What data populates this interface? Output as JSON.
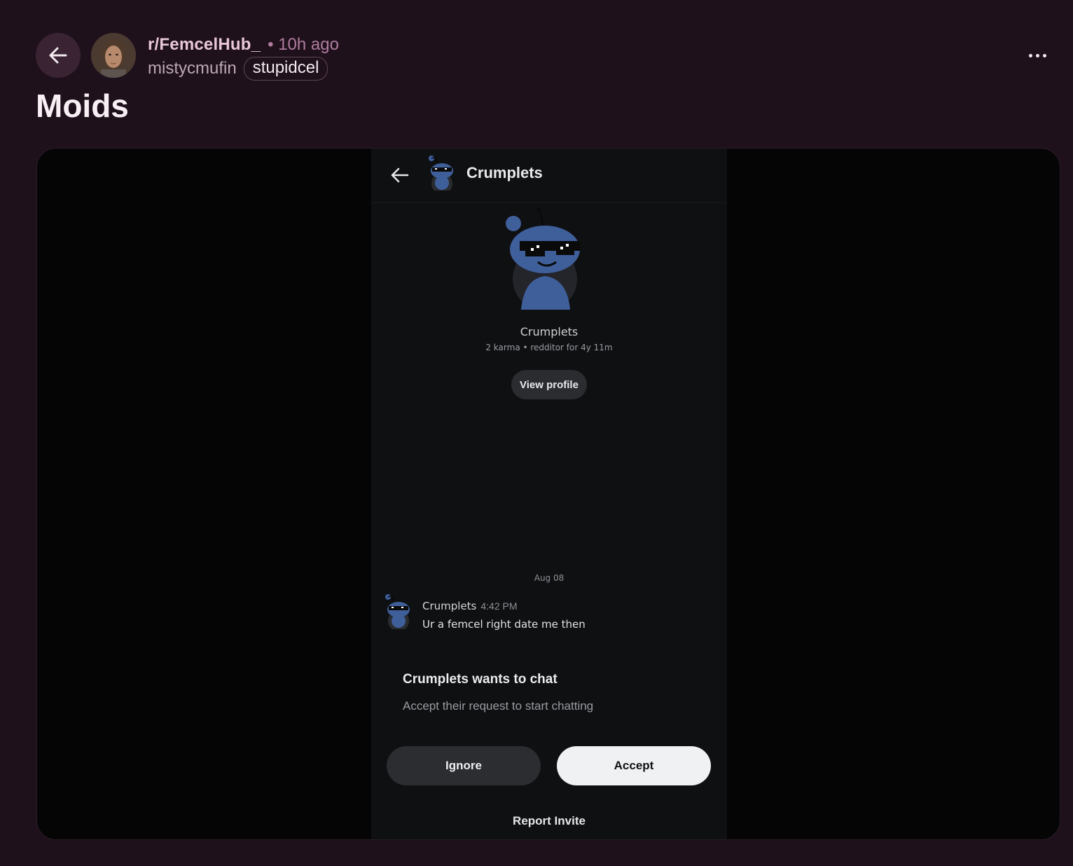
{
  "post": {
    "subreddit": "r/FemcelHub_",
    "time_ago": "• 10h ago",
    "author": "mistycmufin",
    "flair": "stupidcel",
    "title": "Moids"
  },
  "icons": {
    "back": "arrow-left-icon",
    "more": "more-horizontal-icon"
  },
  "screenshot": {
    "top_bar": {
      "name": "Crumplets"
    },
    "profile": {
      "name": "Crumplets",
      "stats": "2 karma • redditor for 4y 11m",
      "view_profile_label": "View profile"
    },
    "date_separator": "Aug 08",
    "message": {
      "author": "Crumplets",
      "time": "4:42 PM",
      "text": "Ur a femcel right date me then"
    },
    "request": {
      "title": "Crumplets wants to chat",
      "subtitle": "Accept their request to start chatting",
      "ignore_label": "Ignore",
      "accept_label": "Accept",
      "report_label": "Report Invite"
    }
  },
  "colors": {
    "page_bg": "#1f111c",
    "subreddit_text": "#e8c7d9",
    "time_text": "#b07c9f",
    "snoo_blue": "#3f5f9b"
  }
}
